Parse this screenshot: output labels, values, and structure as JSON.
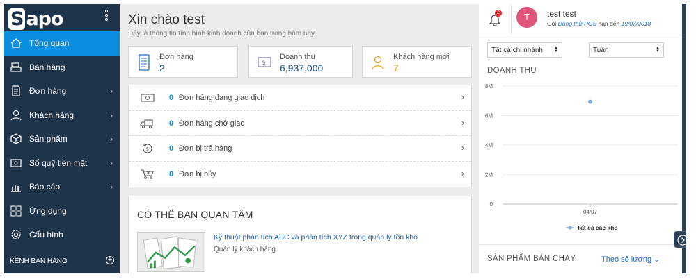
{
  "brand": {
    "name": "Sapo"
  },
  "sidebar": {
    "items": [
      {
        "label": "Tổng quan",
        "icon": "home-icon",
        "has_chevron": false
      },
      {
        "label": "Bán hàng",
        "icon": "pos-register-icon",
        "has_chevron": false
      },
      {
        "label": "Đơn hàng",
        "icon": "order-document-icon",
        "has_chevron": true
      },
      {
        "label": "Khách hàng",
        "icon": "user-icon",
        "has_chevron": true
      },
      {
        "label": "Sản phẩm",
        "icon": "box-icon",
        "has_chevron": true
      },
      {
        "label": "Sổ quỹ tiền mặt",
        "icon": "cash-book-icon",
        "has_chevron": true
      },
      {
        "label": "Báo cáo",
        "icon": "bar-chart-icon",
        "has_chevron": true
      },
      {
        "label": "Ứng dụng",
        "icon": "apps-grid-icon",
        "has_chevron": false
      },
      {
        "label": "Cấu hình",
        "icon": "gear-icon",
        "has_chevron": false
      }
    ],
    "active_index": 0,
    "channels_label": "KÊNH BÁN HÀNG",
    "chevron": "›",
    "plus": "+"
  },
  "main": {
    "greeting": "Xin chào test",
    "subtitle": "Đây là thông tin tình hình kinh doanh của bạn trong hôm nay.",
    "stats": [
      {
        "label": "Đơn hàng",
        "value": "2"
      },
      {
        "label": "Doanh thu",
        "value": "6,937,000"
      },
      {
        "label": "Khách hàng mới",
        "value": "7"
      }
    ],
    "order_statuses": [
      {
        "count": "0",
        "label": "Đơn hàng đang giao dịch",
        "icon": "cash-icon"
      },
      {
        "count": "0",
        "label": "Đơn hàng chờ giao",
        "icon": "truck-icon"
      },
      {
        "count": "0",
        "label": "Đơn bị trả hàng",
        "icon": "refund-icon"
      },
      {
        "count": "0",
        "label": "Đơn bị hủy",
        "icon": "cancelled-cart-icon"
      }
    ],
    "interest": {
      "title": "CÓ THỂ BẠN QUAN TÂM",
      "article_title": "Kỹ thuật phân tích ABC và phân tích XYZ trong quản lý tồn kho",
      "article_category": "Quản lý khách hàng"
    }
  },
  "right": {
    "notification_count": "2",
    "user_initial": "T",
    "user_name": "test test",
    "plan_prefix": "Gói",
    "plan_name": "Dùng thử POS",
    "plan_mid": "hạn đến",
    "plan_date": "19/07/2018",
    "branch_select": "Tất cả chi nhánh",
    "period_select": "Tuần",
    "revenue_title": "DOANH THU",
    "best_seller_title": "SẢN PHẨM BÁN CHẠY",
    "best_seller_sort": "Theo số lượng",
    "dropdown_caret": "⌄"
  },
  "chart_data": {
    "type": "scatter",
    "title": "DOANH THU",
    "x": [
      "04/07"
    ],
    "series": [
      {
        "name": "Tất cả các kho",
        "values": [
          6937000
        ]
      }
    ],
    "yticks": [
      "0",
      "2M",
      "4M",
      "6M",
      "8M"
    ],
    "ylim": [
      0,
      8000000
    ],
    "grid": true,
    "legend": "bottom",
    "color": "#7ab0e0"
  },
  "colors": {
    "sidebar": "#1f3349",
    "active": "#0b8de0",
    "accent_link": "#1d6ed8"
  }
}
